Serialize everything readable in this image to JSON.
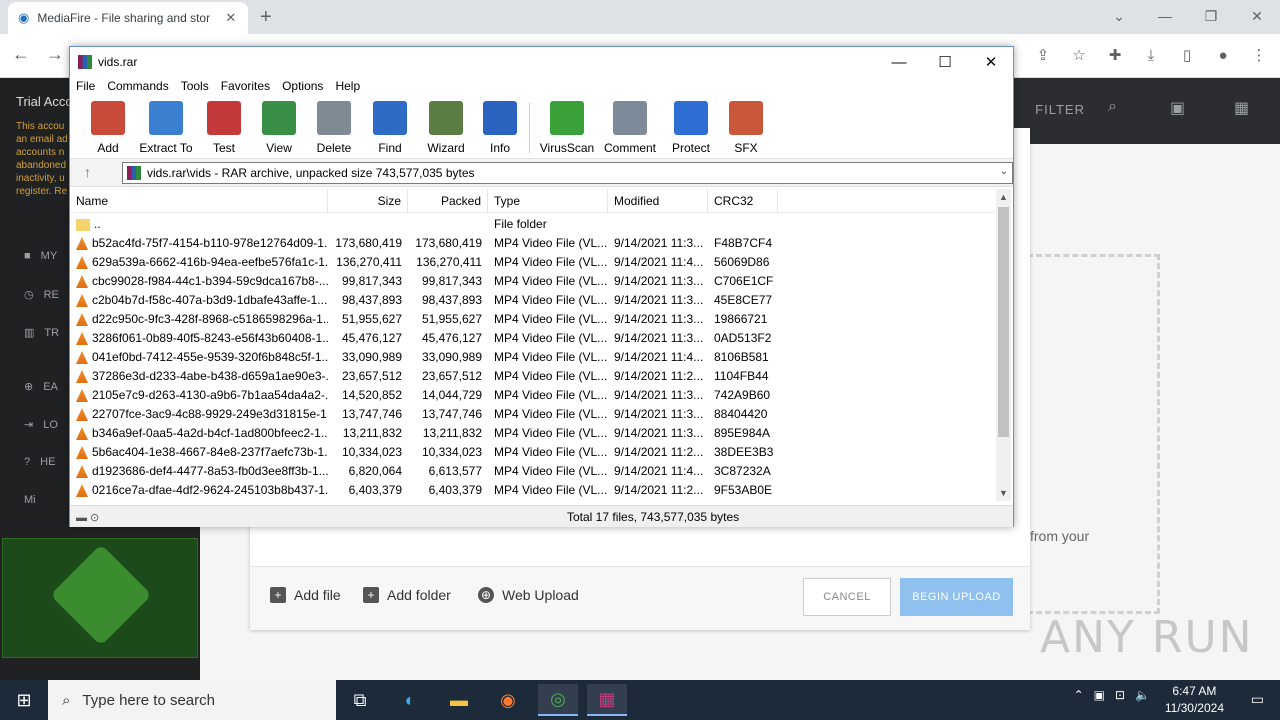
{
  "browser": {
    "tab_title": "MediaFire - File sharing and stor",
    "tab_close": "✕",
    "new_tab": "+"
  },
  "mediafire": {
    "trial_title": "Trial Acco",
    "trial_note": "This accou an email ad accounts n abandoned inactivity, u register. Re",
    "nav": [
      "MY",
      "RE",
      "TR",
      "EA",
      "LO",
      "HE",
      "Mi"
    ],
    "filter_label": "FILTER",
    "from_your": "from your",
    "add_file": "Add file",
    "add_folder": "Add folder",
    "web_upload": "Web Upload",
    "cancel": "CANCEL",
    "begin_upload": "BEGIN UPLOAD"
  },
  "winrar": {
    "title": "vids.rar",
    "menu": [
      "File",
      "Commands",
      "Tools",
      "Favorites",
      "Options",
      "Help"
    ],
    "tools": [
      {
        "label": "Add",
        "icon": "add-icon",
        "color": "#c94b3b"
      },
      {
        "label": "Extract To",
        "icon": "extract-to-icon",
        "color": "#3b7fd0"
      },
      {
        "label": "Test",
        "icon": "test-icon",
        "color": "#c43a3a"
      },
      {
        "label": "View",
        "icon": "view-icon",
        "color": "#3a8f46"
      },
      {
        "label": "Delete",
        "icon": "delete-icon",
        "color": "#7f8a95"
      },
      {
        "label": "Find",
        "icon": "find-icon",
        "color": "#2e6bc6"
      },
      {
        "label": "Wizard",
        "icon": "wizard-icon",
        "color": "#5b7d44"
      },
      {
        "label": "Info",
        "icon": "info-icon",
        "color": "#2a64c0"
      },
      {
        "label": "VirusScan",
        "icon": "virusscan-icon",
        "color": "#3ba23a"
      },
      {
        "label": "Comment",
        "icon": "comment-icon",
        "color": "#7d8a99"
      },
      {
        "label": "Protect",
        "icon": "protect-icon",
        "color": "#2f6ed3"
      },
      {
        "label": "SFX",
        "icon": "sfx-icon",
        "color": "#c9583a"
      }
    ],
    "address": "vids.rar\\vids - RAR archive, unpacked size 743,577,035 bytes",
    "columns": [
      "Name",
      "Size",
      "Packed",
      "Type",
      "Modified",
      "CRC32"
    ],
    "parent_row": {
      "name": "..",
      "type": "File folder"
    },
    "rows": [
      {
        "name": "b52ac4fd-75f7-4154-b110-978e12764d09-1...",
        "size": "173,680,419",
        "packed": "173,680,419",
        "type": "MP4 Video File (VL...",
        "modified": "9/14/2021 11:3...",
        "crc": "F48B7CF4"
      },
      {
        "name": "629a539a-6662-416b-94ea-eefbe576fa1c-1...",
        "size": "136,270,411",
        "packed": "136,270,411",
        "type": "MP4 Video File (VL...",
        "modified": "9/14/2021 11:4...",
        "crc": "56069D86"
      },
      {
        "name": "cbc99028-f984-44c1-b394-59c9dca167b8-...",
        "size": "99,817,343",
        "packed": "99,817,343",
        "type": "MP4 Video File (VL...",
        "modified": "9/14/2021 11:3...",
        "crc": "C706E1CF"
      },
      {
        "name": "c2b04b7d-f58c-407a-b3d9-1dbafe43affe-1...",
        "size": "98,437,893",
        "packed": "98,437,893",
        "type": "MP4 Video File (VL...",
        "modified": "9/14/2021 11:3...",
        "crc": "45E8CE77"
      },
      {
        "name": "d22c950c-9fc3-428f-8968-c5186598296a-1...",
        "size": "51,955,627",
        "packed": "51,955,627",
        "type": "MP4 Video File (VL...",
        "modified": "9/14/2021 11:3...",
        "crc": "19866721"
      },
      {
        "name": "3286f061-0b89-40f5-8243-e56f43b60408-1...",
        "size": "45,476,127",
        "packed": "45,476,127",
        "type": "MP4 Video File (VL...",
        "modified": "9/14/2021 11:3...",
        "crc": "0AD513F2"
      },
      {
        "name": "041ef0bd-7412-455e-9539-320f6b848c5f-1...",
        "size": "33,090,989",
        "packed": "33,090,989",
        "type": "MP4 Video File (VL...",
        "modified": "9/14/2021 11:4...",
        "crc": "8106B581"
      },
      {
        "name": "37286e3d-d233-4abe-b438-d659a1ae90e3-...",
        "size": "23,657,512",
        "packed": "23,657,512",
        "type": "MP4 Video File (VL...",
        "modified": "9/14/2021 11:2...",
        "crc": "1104FB44"
      },
      {
        "name": "2105e7c9-d263-4130-a9b6-7b1aa54da4a2-...",
        "size": "14,520,852",
        "packed": "14,044,729",
        "type": "MP4 Video File (VL...",
        "modified": "9/14/2021 11:3...",
        "crc": "742A9B60"
      },
      {
        "name": "22707fce-3ac9-4c88-9929-249e3d31815e-1...",
        "size": "13,747,746",
        "packed": "13,747,746",
        "type": "MP4 Video File (VL...",
        "modified": "9/14/2021 11:3...",
        "crc": "88404420"
      },
      {
        "name": "b346a9ef-0aa5-4a2d-b4cf-1ad800bfeec2-1...",
        "size": "13,211,832",
        "packed": "13,211,832",
        "type": "MP4 Video File (VL...",
        "modified": "9/14/2021 11:3...",
        "crc": "895E984A"
      },
      {
        "name": "5b6ac404-1e38-4667-84e8-237f7aefc73b-1...",
        "size": "10,334,023",
        "packed": "10,334,023",
        "type": "MP4 Video File (VL...",
        "modified": "9/14/2021 11:2...",
        "crc": "38DEE3B3"
      },
      {
        "name": "d1923686-def4-4477-8a53-fb0d3ee8ff3b-1...",
        "size": "6,820,064",
        "packed": "6,613,577",
        "type": "MP4 Video File (VL...",
        "modified": "9/14/2021 11:4...",
        "crc": "3C87232A"
      },
      {
        "name": "0216ce7a-dfae-4df2-9624-245103b8b437-1...",
        "size": "6,403,379",
        "packed": "6,403,379",
        "type": "MP4 Video File (VL...",
        "modified": "9/14/2021 11:2...",
        "crc": "9F53AB0E"
      }
    ],
    "status": "Total 17 files, 743,577,035 bytes"
  },
  "taskbar": {
    "search_placeholder": "Type here to search",
    "time": "6:47 AM",
    "date": "11/30/2024"
  },
  "watermark": "ANY RUN"
}
